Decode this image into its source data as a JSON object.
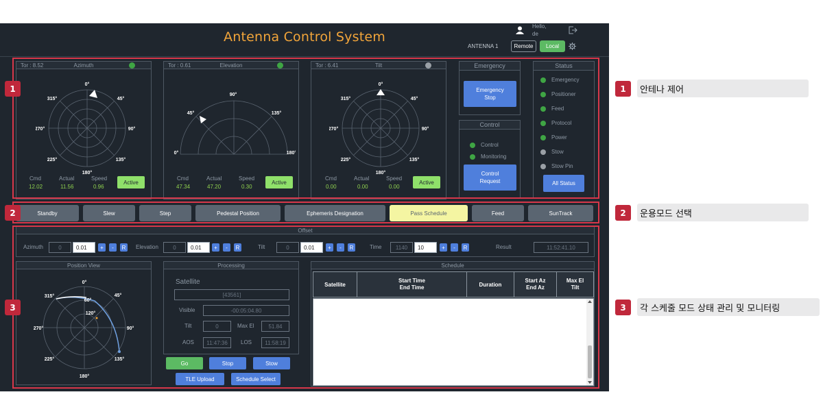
{
  "header": {
    "title": "Antenna Control System",
    "greeting": "Hello,",
    "username": "de",
    "antenna": "ANTENNA 1",
    "remote": "Remote",
    "local": "Local"
  },
  "azimuth": {
    "title": "Azimuth",
    "tor": "Tor : 8.52",
    "cmd_label": "Cmd",
    "actual_label": "Actual",
    "speed_label": "Speed",
    "cmd": "12.02",
    "actual": "11.56",
    "speed": "0.96",
    "active": "Active"
  },
  "elevation": {
    "title": "Elevation",
    "tor": "Tor : 0.61",
    "cmd_label": "Cmd",
    "actual_label": "Actual",
    "speed_label": "Speed",
    "cmd": "47.34",
    "actual": "47.20",
    "speed": "0.30",
    "active": "Active"
  },
  "tilt": {
    "title": "Tilt",
    "tor": "Tor : 6.41",
    "cmd_label": "Cmd",
    "actual_label": "Actual",
    "speed_label": "Speed",
    "cmd": "0.00",
    "actual": "0.00",
    "speed": "0.00",
    "active": "Active"
  },
  "compass": {
    "n": "0°",
    "ne": "45°",
    "e": "90°",
    "se": "135°",
    "s": "180°",
    "sw": "225°",
    "w": "270°",
    "nw": "315°"
  },
  "semi": {
    "z": "0°",
    "a45": "45°",
    "a90": "90°",
    "a135": "135°",
    "a180": "180°"
  },
  "emergency": {
    "title": "Emergency",
    "button_line1": "Emergency",
    "button_line2": "Stop"
  },
  "control": {
    "title": "Control",
    "items": [
      "Control",
      "Monitoring"
    ],
    "button_line1": "Control",
    "button_line2": "Request"
  },
  "status": {
    "title": "Status",
    "items": [
      "Emergency",
      "Positioner",
      "Feed",
      "Protocol",
      "Power",
      "Stow",
      "Stow Pin"
    ],
    "button": "All Status"
  },
  "modes": [
    "Standby",
    "Slew",
    "Step",
    "Pedestal Position",
    "Ephemeris Designation",
    "Pass Schedule",
    "Feed",
    "SunTrack"
  ],
  "offset": {
    "title": "Offset",
    "az_label": "Azimuth",
    "az_val": "0",
    "az_step": "0.01",
    "el_label": "Elevation",
    "el_val": "0",
    "el_step": "0.01",
    "tilt_label": "Tilt",
    "tilt_val": "0",
    "tilt_step": "0.01",
    "time_label": "Time",
    "time_val": "1140",
    "time_step": "10",
    "result_label": "Result",
    "result": "11:52:41.10",
    "plus": "+",
    "minus": "-",
    "reset": "R"
  },
  "position_view": {
    "title": "Position View",
    "inner_60": "60°",
    "inner_120": "120°"
  },
  "processing": {
    "title": "Processing",
    "satellite_label": "Satellite",
    "satellite": "[43561]",
    "visible_label": "Visible",
    "visible": "-00:05:04.80",
    "tilt_label": "Tilt",
    "tilt": "0",
    "maxel_label": "Max El",
    "maxel": "51.84",
    "aos_label": "AOS",
    "aos": "11:47:36",
    "los_label": "LOS",
    "los": "11:58:19",
    "go": "Go",
    "stop": "Stop",
    "stow": "Stow",
    "tle": "TLE Upload",
    "sched_select": "Schedule Select"
  },
  "schedule": {
    "title": "Schedule",
    "col_satellite": "Satellite",
    "col_start": "Start Time",
    "col_end": "End Time",
    "col_duration": "Duration",
    "col_startaz": "Start Az",
    "col_endaz": "End Az",
    "col_maxel": "Max El",
    "col_tilt": "Tilt"
  },
  "annotations": [
    {
      "num": "1",
      "text": "안테나 제어"
    },
    {
      "num": "2",
      "text": "운용모드 선택"
    },
    {
      "num": "3",
      "text": "각 스케줄 모드 상태 관리 및 모니터링"
    }
  ]
}
